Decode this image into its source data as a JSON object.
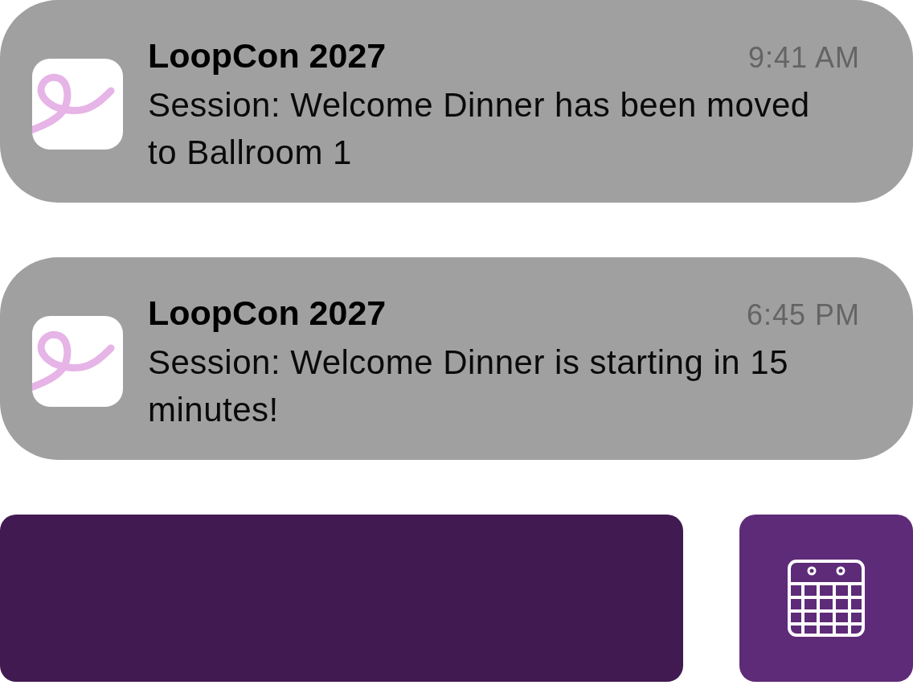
{
  "notifications": [
    {
      "app_name": "LoopCon 2027",
      "time": "9:41 AM",
      "message": "Session: Welcome Dinner has been moved to Ballroom 1"
    },
    {
      "app_name": "LoopCon 2027",
      "time": "6:45 PM",
      "message": "Session: Welcome Dinner is starting in 15 minutes!"
    }
  ]
}
